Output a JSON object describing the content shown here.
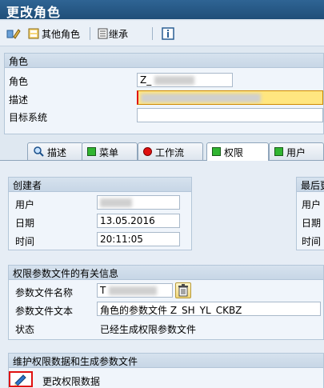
{
  "window": {
    "title": "更改角色"
  },
  "toolbar": {
    "other_role_label": "其他角色",
    "inherit_label": "继承"
  },
  "role": {
    "group_title": "角色",
    "role_label": "角色",
    "role_value": "Z_",
    "desc_label": "描述",
    "target_label": "目标系统"
  },
  "tabs": [
    {
      "label": "描述"
    },
    {
      "label": "菜单"
    },
    {
      "label": "工作流"
    },
    {
      "label": "权限"
    },
    {
      "label": "用户"
    }
  ],
  "creator": {
    "title": "创建者",
    "user_label": "用户",
    "date_label": "日期",
    "date_value": "13.05.2016",
    "time_label": "时间",
    "time_value": "20:11:05"
  },
  "last_change": {
    "title": "最后更",
    "user_label": "用户",
    "date_label": "日期",
    "time_label": "时间"
  },
  "profile": {
    "title": "权限参数文件的有关信息",
    "name_label": "参数文件名称",
    "name_value": "T",
    "text_label": "参数文件文本",
    "text_value": "角色的参数文件 Z_SH_YL_CKBZ",
    "status_label": "状态",
    "status_value": "已经生成权限参数文件"
  },
  "maintain": {
    "title": "维护权限数据和生成参数文件",
    "change_label": "更改权限数据"
  },
  "colors": {
    "title_bar": "#1f4e78",
    "active_status": "#31b531",
    "workflow_status": "#e01010",
    "highlight_field": "#ffe680"
  }
}
